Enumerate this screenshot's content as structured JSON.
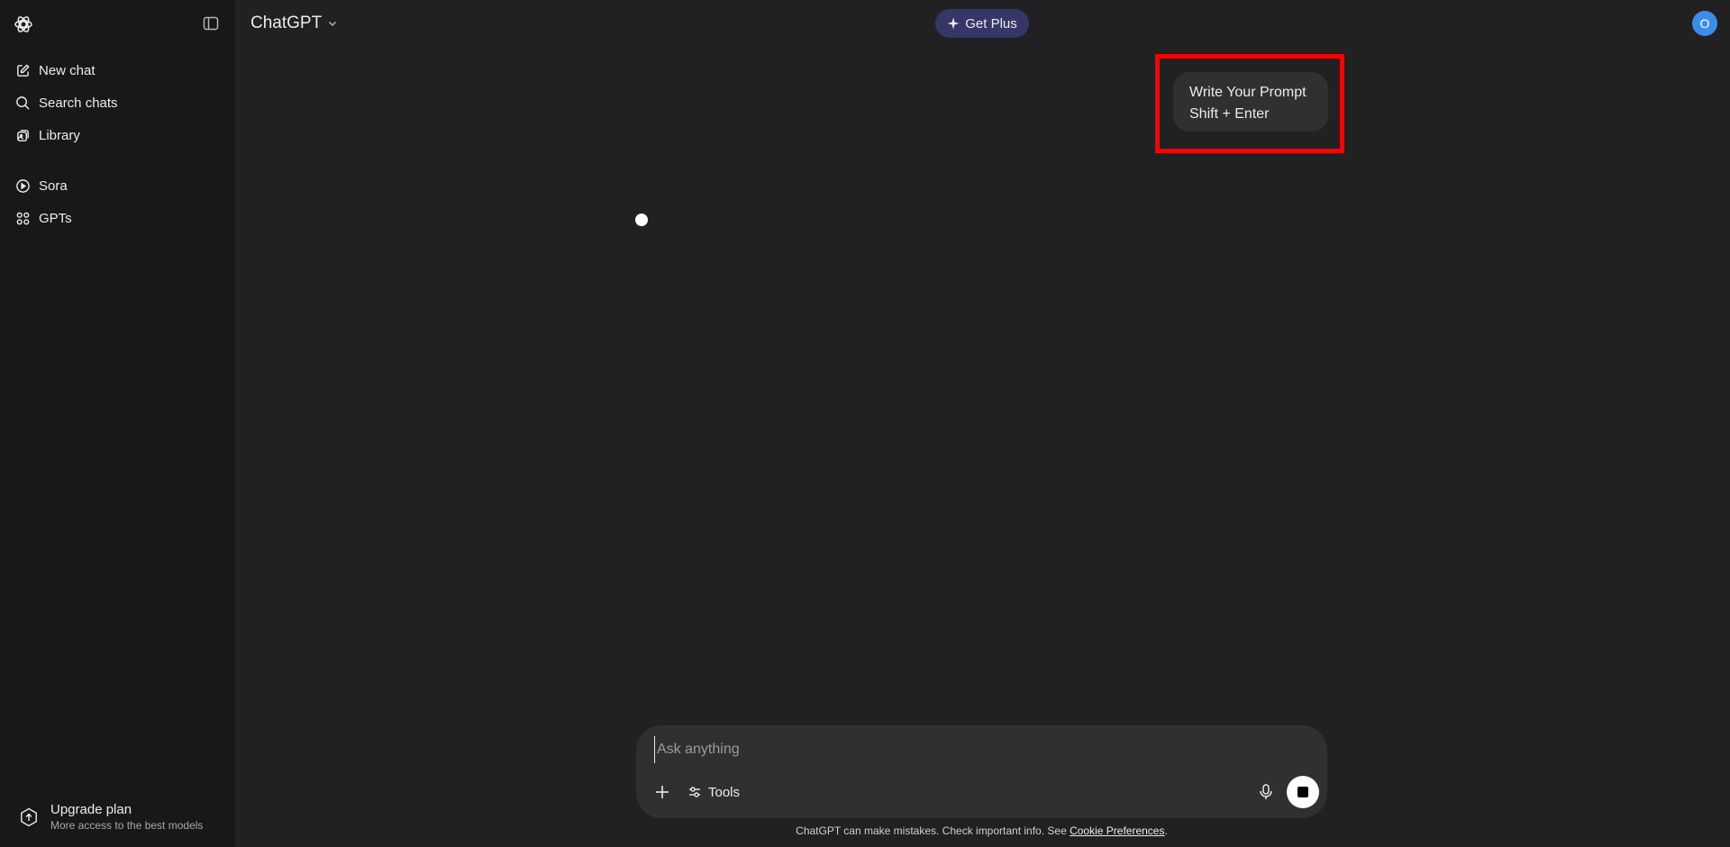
{
  "header": {
    "model_label": "ChatGPT",
    "get_plus_label": "Get Plus",
    "avatar_initial": "O"
  },
  "sidebar": {
    "items": [
      {
        "label": "New chat",
        "icon": "new-chat-icon"
      },
      {
        "label": "Search chats",
        "icon": "search-icon"
      },
      {
        "label": "Library",
        "icon": "library-icon"
      },
      {
        "label": "Sora",
        "icon": "play-icon"
      },
      {
        "label": "GPTs",
        "icon": "grid-icon"
      }
    ],
    "upgrade": {
      "title": "Upgrade plan",
      "subtitle": "More access to the best models",
      "icon": "upgrade-icon"
    }
  },
  "conversation": {
    "user_message_line1": "Write Your Prompt",
    "user_message_line2": "Shift + Enter"
  },
  "composer": {
    "placeholder": "Ask anything",
    "value": "",
    "tools_label": "Tools"
  },
  "footer": {
    "disclaimer": "ChatGPT can make mistakes. Check important info. See ",
    "link_text": "Cookie Preferences",
    "suffix": "."
  },
  "colors": {
    "background": "#212121",
    "sidebar": "#181818",
    "get_plus_bg": "#373669",
    "avatar": "#3b8ee8",
    "highlight": "#ff0000"
  }
}
